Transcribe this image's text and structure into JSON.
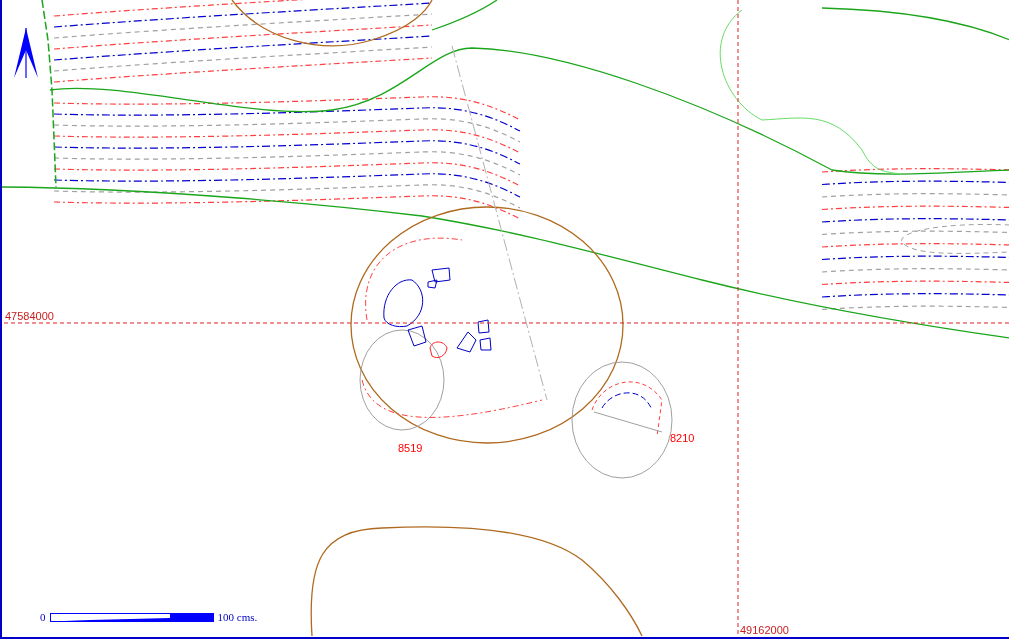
{
  "grid_labels": [
    {
      "kind": "northing",
      "text": "47584000"
    },
    {
      "kind": "easting",
      "text": "49162000"
    }
  ],
  "feature_labels": [
    {
      "text": "8519"
    },
    {
      "text": "8210"
    }
  ],
  "scale_bar": {
    "start": "0",
    "end": "100 cms."
  }
}
